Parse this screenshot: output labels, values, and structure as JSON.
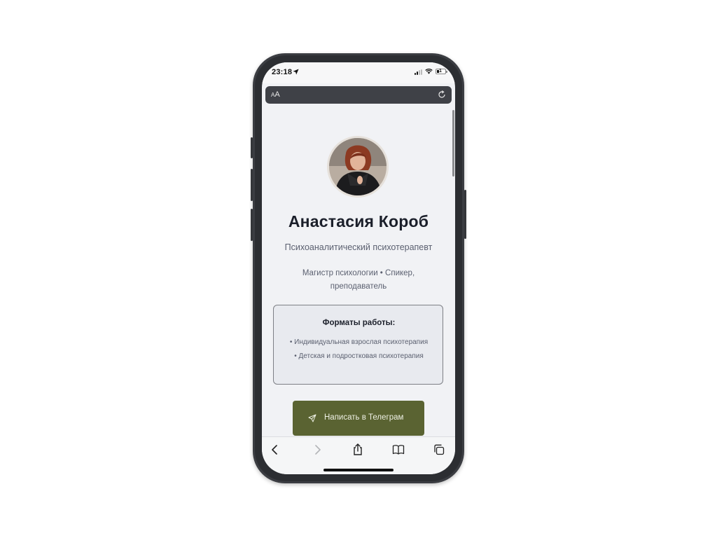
{
  "status_bar": {
    "time": "23:18",
    "battery_level": "1"
  },
  "address_bar": {
    "aa_small": "A",
    "aa_large": "A"
  },
  "profile": {
    "name": "Анастасия Короб",
    "subtitle": "Психоаналитический психотерапевт",
    "credentials": "Магистр психологии • Спикер, преподаватель"
  },
  "formats": {
    "title": "Форматы работы:",
    "items": [
      "• Индивидуальная взрослая психотерапия",
      "• Детская и подростковая психотерапия"
    ]
  },
  "cta": {
    "label": "Написать в Телеграм"
  },
  "icons": {
    "location": "location-arrow-icon",
    "signal": "cellular-signal-icon",
    "wifi": "wifi-icon",
    "battery": "battery-icon",
    "reload": "reload-icon",
    "send": "send-icon",
    "back": "chevron-left-icon",
    "forward": "chevron-right-icon",
    "share": "share-icon",
    "bookmarks": "book-icon",
    "tabs": "tabs-icon"
  },
  "colors": {
    "accent": "#5a6332",
    "page_background": "#f1f2f5",
    "text_primary": "#1b1f2a",
    "text_secondary": "#5b6070",
    "phone_frame": "#3b3d42"
  }
}
